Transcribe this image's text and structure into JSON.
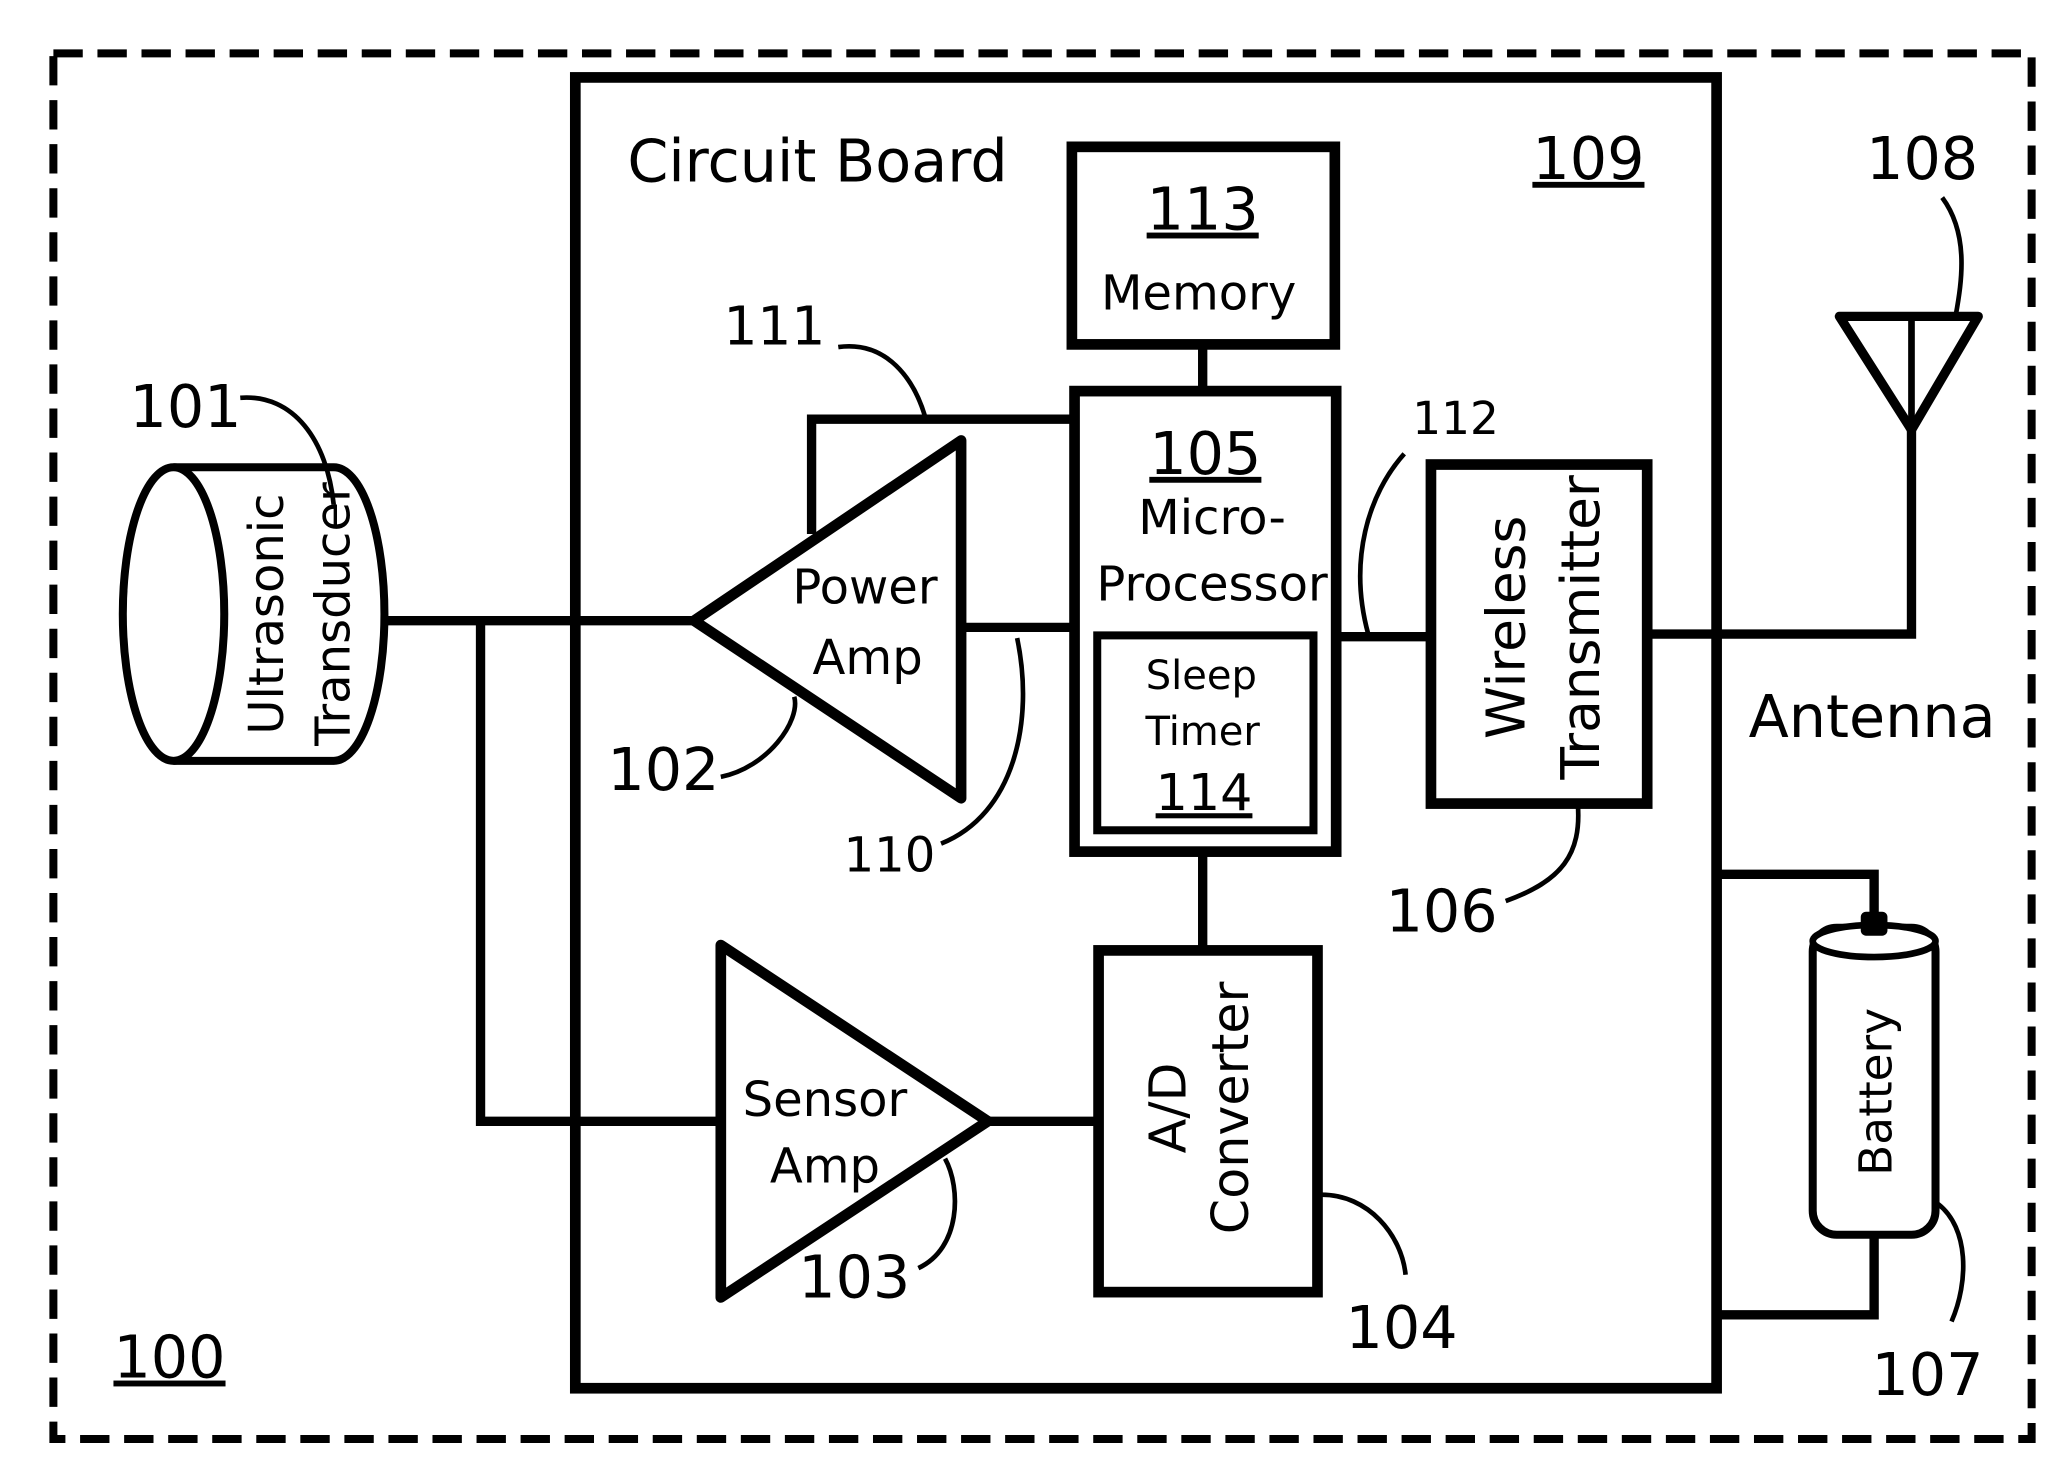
{
  "figure": {
    "ref": "100",
    "circuit_board": {
      "title": "Circuit Board",
      "ref": "109"
    },
    "components": {
      "transducer": {
        "line1": "Ultrasonic",
        "line2": "Transducer",
        "ref": "101"
      },
      "power_amp": {
        "line1": "Power",
        "line2": "Amp",
        "ref": "102"
      },
      "sensor_amp": {
        "line1": "Sensor",
        "line2": "Amp",
        "ref": "103"
      },
      "ad_converter": {
        "line1": "A/D",
        "line2": "Converter",
        "ref": "104"
      },
      "microprocessor": {
        "line1": "Micro-",
        "line2": "Processor",
        "ref": "105"
      },
      "wireless_transmitter": {
        "line1": "Wireless",
        "line2": "Transmitter",
        "ref": "106"
      },
      "battery": {
        "label": "Battery",
        "ref": "107"
      },
      "antenna": {
        "label": "Antenna",
        "ref": "108"
      },
      "memory": {
        "label": "Memory",
        "ref": "113"
      },
      "sleep_timer": {
        "line1": "Sleep",
        "line2": "Timer",
        "ref": "114"
      }
    },
    "connections": {
      "power_amp_out": "110",
      "power_amp_control": "111",
      "transmitter_link": "112"
    }
  }
}
